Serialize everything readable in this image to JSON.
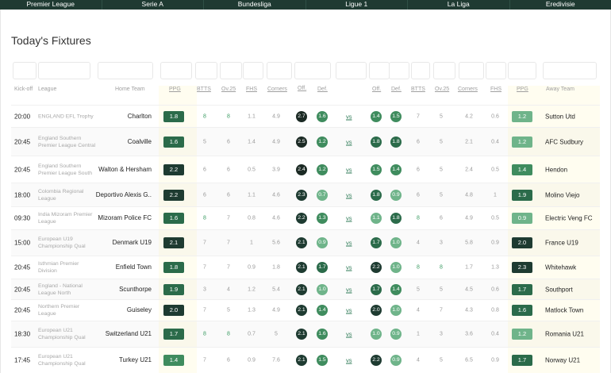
{
  "nav": {
    "tabs": [
      "Premier League",
      "Serie A",
      "Bundesliga",
      "Ligue 1",
      "La Liga",
      "Eredivisie"
    ]
  },
  "page": {
    "title": "Today's Fixtures"
  },
  "headers": {
    "kickoff": "Kick-off",
    "league": "League",
    "home_team": "Home Team",
    "ppg_home": "PPG",
    "btts_home": "BTTS",
    "ov25_home": "Ov.25",
    "fhs_home": "FHS",
    "corners_home": "Corners",
    "off_home": "Off.",
    "def_home": "Def.",
    "off_away": "Off.",
    "def_away": "Def.",
    "btts_away": "BTTS",
    "ov25_away": "Ov.25",
    "corners_away": "Corners",
    "fhs_away": "FHS",
    "ppg_away": "PPG",
    "away_team": "Away Team"
  },
  "colors": {
    "dark": "#1e3b31",
    "mid": "#2b6b4a",
    "green": "#3f8c5e",
    "light": "#6fb48a",
    "nav": "#1f3a32"
  },
  "fixtures": [
    {
      "time": "20:00",
      "league": "ENGLAND EFL Trophy",
      "home": "Charlton",
      "ppg_h": "1.8",
      "btts_h": "8",
      "ov_h": "8",
      "fhs_h": "1.1",
      "cor_h": "4.9",
      "off_h": "2.7",
      "def_h": "1.6",
      "vs": "vs",
      "off_a": "1.4",
      "def_a": "1.5",
      "btts_a": "7",
      "ov_a": "5",
      "cor_a": "4.2",
      "fhs_a": "0.6",
      "ppg_a": "1.2",
      "away": "Sutton Utd"
    },
    {
      "time": "20:45",
      "league": "England Southern Premier League Central",
      "home": "Coalville",
      "ppg_h": "1.6",
      "btts_h": "5",
      "ov_h": "6",
      "fhs_h": "1.4",
      "cor_h": "4.9",
      "off_h": "2.5",
      "def_h": "1.2",
      "vs": "vs",
      "off_a": "1.8",
      "def_a": "1.8",
      "btts_a": "6",
      "ov_a": "5",
      "cor_a": "2.1",
      "fhs_a": "0.4",
      "ppg_a": "1.2",
      "away": "AFC Sudbury"
    },
    {
      "time": "20:45",
      "league": "England Southern Premier League South",
      "home": "Walton & Hersham",
      "ppg_h": "2.2",
      "btts_h": "6",
      "ov_h": "6",
      "fhs_h": "0.5",
      "cor_h": "3.9",
      "off_h": "2.4",
      "def_h": "1.2",
      "vs": "vs",
      "off_a": "1.5",
      "def_a": "1.4",
      "btts_a": "6",
      "ov_a": "5",
      "cor_a": "2.4",
      "fhs_a": "0.5",
      "ppg_a": "1.4",
      "away": "Hendon"
    },
    {
      "time": "18:00",
      "league": "Colombia Regional League",
      "home": "Deportivo Alexis G..",
      "ppg_h": "2.2",
      "btts_h": "6",
      "ov_h": "6",
      "fhs_h": "1.1",
      "cor_h": "4.6",
      "off_h": "2.3",
      "def_h": "0.7",
      "vs": "vs",
      "off_a": "1.8",
      "def_a": "0.9",
      "btts_a": "6",
      "ov_a": "5",
      "cor_a": "4.8",
      "fhs_a": "1",
      "ppg_a": "1.9",
      "away": "Molino Viejo"
    },
    {
      "time": "09:30",
      "league": "India Mizoram Premier League",
      "home": "Mizoram Police FC",
      "ppg_h": "1.6",
      "btts_h": "8",
      "ov_h": "7",
      "fhs_h": "0.8",
      "cor_h": "4.6",
      "off_h": "2.2",
      "def_h": "1.3",
      "vs": "vs",
      "off_a": "1.1",
      "def_a": "1.8",
      "btts_a": "8",
      "ov_a": "6",
      "cor_a": "4.9",
      "fhs_a": "0.5",
      "ppg_a": "0.9",
      "away": "Electric Veng FC"
    },
    {
      "time": "15:00",
      "league": "European U19 Championship Qual",
      "home": "Denmark U19",
      "ppg_h": "2.1",
      "btts_h": "7",
      "ov_h": "7",
      "fhs_h": "1",
      "cor_h": "5.6",
      "off_h": "2.1",
      "def_h": "0.9",
      "vs": "vs",
      "off_a": "1.7",
      "def_a": "1.0",
      "btts_a": "4",
      "ov_a": "3",
      "cor_a": "5.8",
      "fhs_a": "0.9",
      "ppg_a": "2.0",
      "away": "France U19"
    },
    {
      "time": "20:45",
      "league": "Isthmian Premier Division",
      "home": "Enfield Town",
      "ppg_h": "1.8",
      "btts_h": "7",
      "ov_h": "7",
      "fhs_h": "0.9",
      "cor_h": "1.8",
      "off_h": "2.1",
      "def_h": "1.7",
      "vs": "vs",
      "off_a": "2.2",
      "def_a": "1.0",
      "btts_a": "8",
      "ov_a": "8",
      "cor_a": "1.7",
      "fhs_a": "1.3",
      "ppg_a": "2.3",
      "away": "Whitehawk"
    },
    {
      "time": "20:45",
      "league": "England - National League North",
      "home": "Scunthorpe",
      "ppg_h": "1.9",
      "btts_h": "3",
      "ov_h": "4",
      "fhs_h": "1.2",
      "cor_h": "5.4",
      "off_h": "2.1",
      "def_h": "1.0",
      "vs": "vs",
      "off_a": "1.7",
      "def_a": "1.4",
      "btts_a": "5",
      "ov_a": "5",
      "cor_a": "4.5",
      "fhs_a": "0.6",
      "ppg_a": "1.7",
      "away": "Southport"
    },
    {
      "time": "20:45",
      "league": "Northern Premier League",
      "home": "Guiseley",
      "ppg_h": "2.0",
      "btts_h": "7",
      "ov_h": "5",
      "fhs_h": "1.3",
      "cor_h": "4.9",
      "off_h": "2.1",
      "def_h": "1.4",
      "vs": "vs",
      "off_a": "2.0",
      "def_a": "1.0",
      "btts_a": "4",
      "ov_a": "7",
      "cor_a": "4.3",
      "fhs_a": "0.8",
      "ppg_a": "1.6",
      "away": "Matlock Town"
    },
    {
      "time": "18:30",
      "league": "European U21 Championship Qual",
      "home": "Switzerland U21",
      "ppg_h": "1.7",
      "btts_h": "8",
      "ov_h": "8",
      "fhs_h": "0.7",
      "cor_h": "5",
      "off_h": "2.1",
      "def_h": "1.6",
      "vs": "vs",
      "off_a": "1.0",
      "def_a": "0.9",
      "btts_a": "1",
      "ov_a": "3",
      "cor_a": "3.6",
      "fhs_a": "0.4",
      "ppg_a": "1.2",
      "away": "Romania U21"
    },
    {
      "time": "17:45",
      "league": "European U21 Championship Qual",
      "home": "Turkey U21",
      "ppg_h": "1.4",
      "btts_h": "7",
      "ov_h": "6",
      "fhs_h": "0.9",
      "cor_h": "7.6",
      "off_h": "2.1",
      "def_h": "1.5",
      "vs": "vs",
      "off_a": "2.2",
      "def_a": "0.9",
      "btts_a": "4",
      "ov_a": "5",
      "cor_a": "6.5",
      "fhs_a": "0.9",
      "ppg_a": "1.7",
      "away": "Norway U21"
    }
  ]
}
